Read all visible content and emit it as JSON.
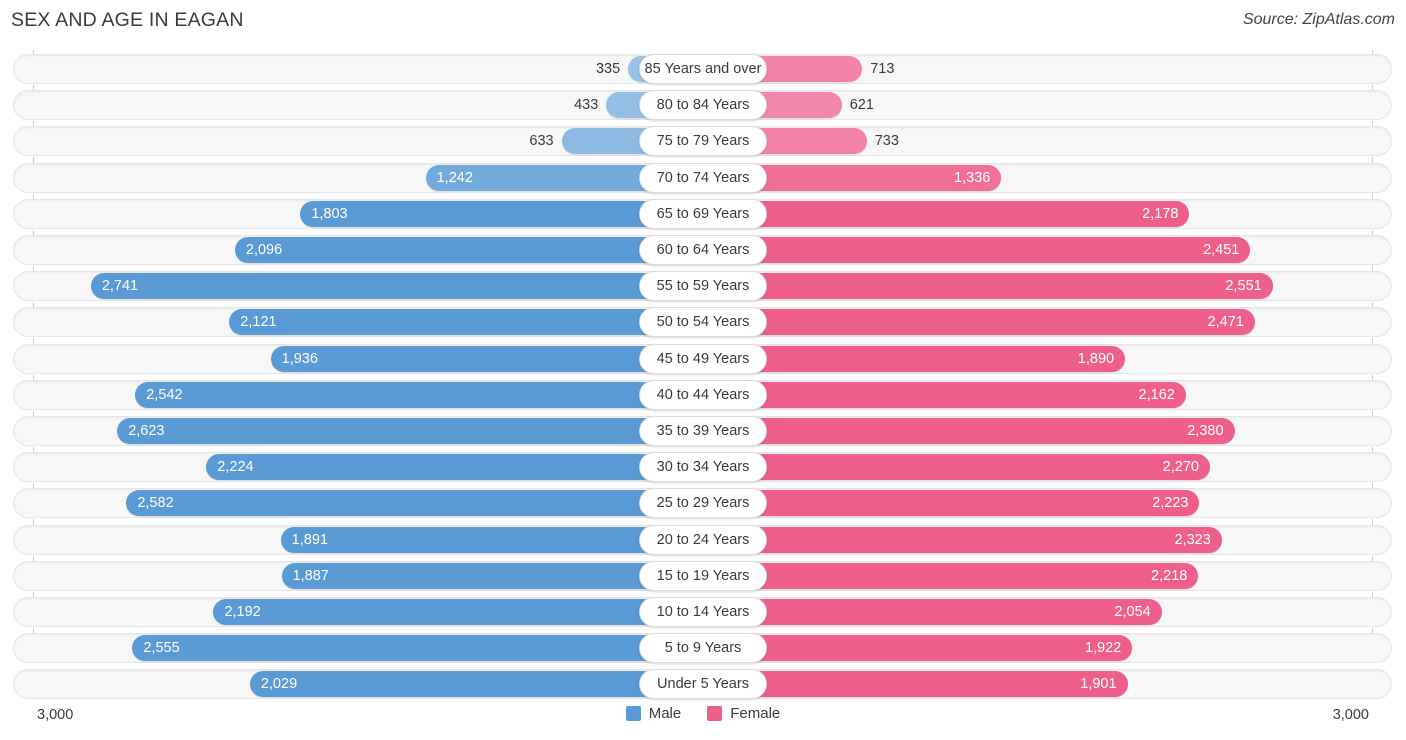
{
  "header": {
    "title": "SEX AND AGE IN EAGAN",
    "source": "Source: ZipAtlas.com"
  },
  "legend": {
    "male_label": "Male",
    "female_label": "Female",
    "male_color": "#5b9bd5",
    "female_color": "#ef5f8c"
  },
  "axis": {
    "left_label": "3,000",
    "right_label": "3,000",
    "max": 3000
  },
  "chart_data": {
    "type": "bar",
    "subtype": "population-pyramid",
    "title": "SEX AND AGE IN EAGAN",
    "subtitle": "Source: ZipAtlas.com",
    "xlabel": "",
    "ylabel": "",
    "xlim": [
      3000,
      0,
      3000
    ],
    "grid": true,
    "legend_position": "bottom-center",
    "categories": [
      "85 Years and over",
      "80 to 84 Years",
      "75 to 79 Years",
      "70 to 74 Years",
      "65 to 69 Years",
      "60 to 64 Years",
      "55 to 59 Years",
      "50 to 54 Years",
      "45 to 49 Years",
      "40 to 44 Years",
      "35 to 39 Years",
      "30 to 34 Years",
      "25 to 29 Years",
      "20 to 24 Years",
      "15 to 19 Years",
      "10 to 14 Years",
      "5 to 9 Years",
      "Under 5 Years"
    ],
    "series": [
      {
        "name": "Male",
        "color": "#5b9bd5",
        "values": [
          335,
          433,
          633,
          1242,
          1803,
          2096,
          2741,
          2121,
          1936,
          2542,
          2623,
          2224,
          2582,
          1891,
          1887,
          2192,
          2555,
          2029
        ],
        "labels": [
          "335",
          "433",
          "633",
          "1,242",
          "1,803",
          "2,096",
          "2,741",
          "2,121",
          "1,936",
          "2,542",
          "2,623",
          "2,224",
          "2,582",
          "1,891",
          "1,887",
          "2,192",
          "2,555",
          "2,029"
        ]
      },
      {
        "name": "Female",
        "color": "#ef5f8c",
        "values": [
          713,
          621,
          733,
          1336,
          2178,
          2451,
          2551,
          2471,
          1890,
          2162,
          2380,
          2270,
          2223,
          2323,
          2218,
          2054,
          1922,
          1901
        ],
        "labels": [
          "713",
          "621",
          "733",
          "1,336",
          "2,178",
          "2,451",
          "2,551",
          "2,471",
          "1,890",
          "2,162",
          "2,380",
          "2,270",
          "2,223",
          "2,323",
          "2,218",
          "2,054",
          "1,922",
          "1,901"
        ]
      }
    ]
  }
}
